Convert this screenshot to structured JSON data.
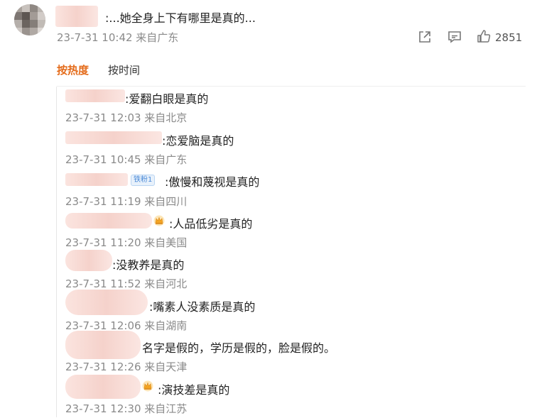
{
  "post": {
    "text": ":...她全身上下有哪里是真的...",
    "meta": "23-7-31 10:42 来自广东",
    "like_count": "2851"
  },
  "tabs": [
    {
      "label": "按热度",
      "active": true
    },
    {
      "label": "按时间",
      "active": false
    }
  ],
  "replies": [
    {
      "text": ":爱翻白眼是真的",
      "meta": "23-7-31 12:03 来自北京"
    },
    {
      "text": ":恋爱脑是真的",
      "meta": "23-7-31 10:45 来自广东"
    },
    {
      "text": ":傲慢和蔑视是真的",
      "meta": "23-7-31 11:19 来自四川",
      "badge": "铁粉1"
    },
    {
      "text": ":人品低劣是真的",
      "meta": "23-7-31 11:20 来自美国",
      "crown": true
    },
    {
      "text": ":没教养是真的",
      "meta": "23-7-31 11:52 来自河北"
    },
    {
      "text": ":嘴素人没素质是真的",
      "meta": "23-7-31 12:06 来自湖南"
    },
    {
      "text": "名字是假的，学历是假的，脸是假的。",
      "meta": "23-7-31 12:26 来自天津"
    },
    {
      "text": ":演技差是真的",
      "meta": "23-7-31 12:30 来自江苏",
      "crown": true
    }
  ],
  "icons": {
    "share": "share-icon",
    "comment": "comment-icon",
    "like": "thumbs-up-icon",
    "crown": "crown-icon"
  },
  "colors": {
    "accent": "#e46b1a",
    "meta_gray": "#8a8a8a",
    "fan_badge": "#4a8ad8"
  }
}
